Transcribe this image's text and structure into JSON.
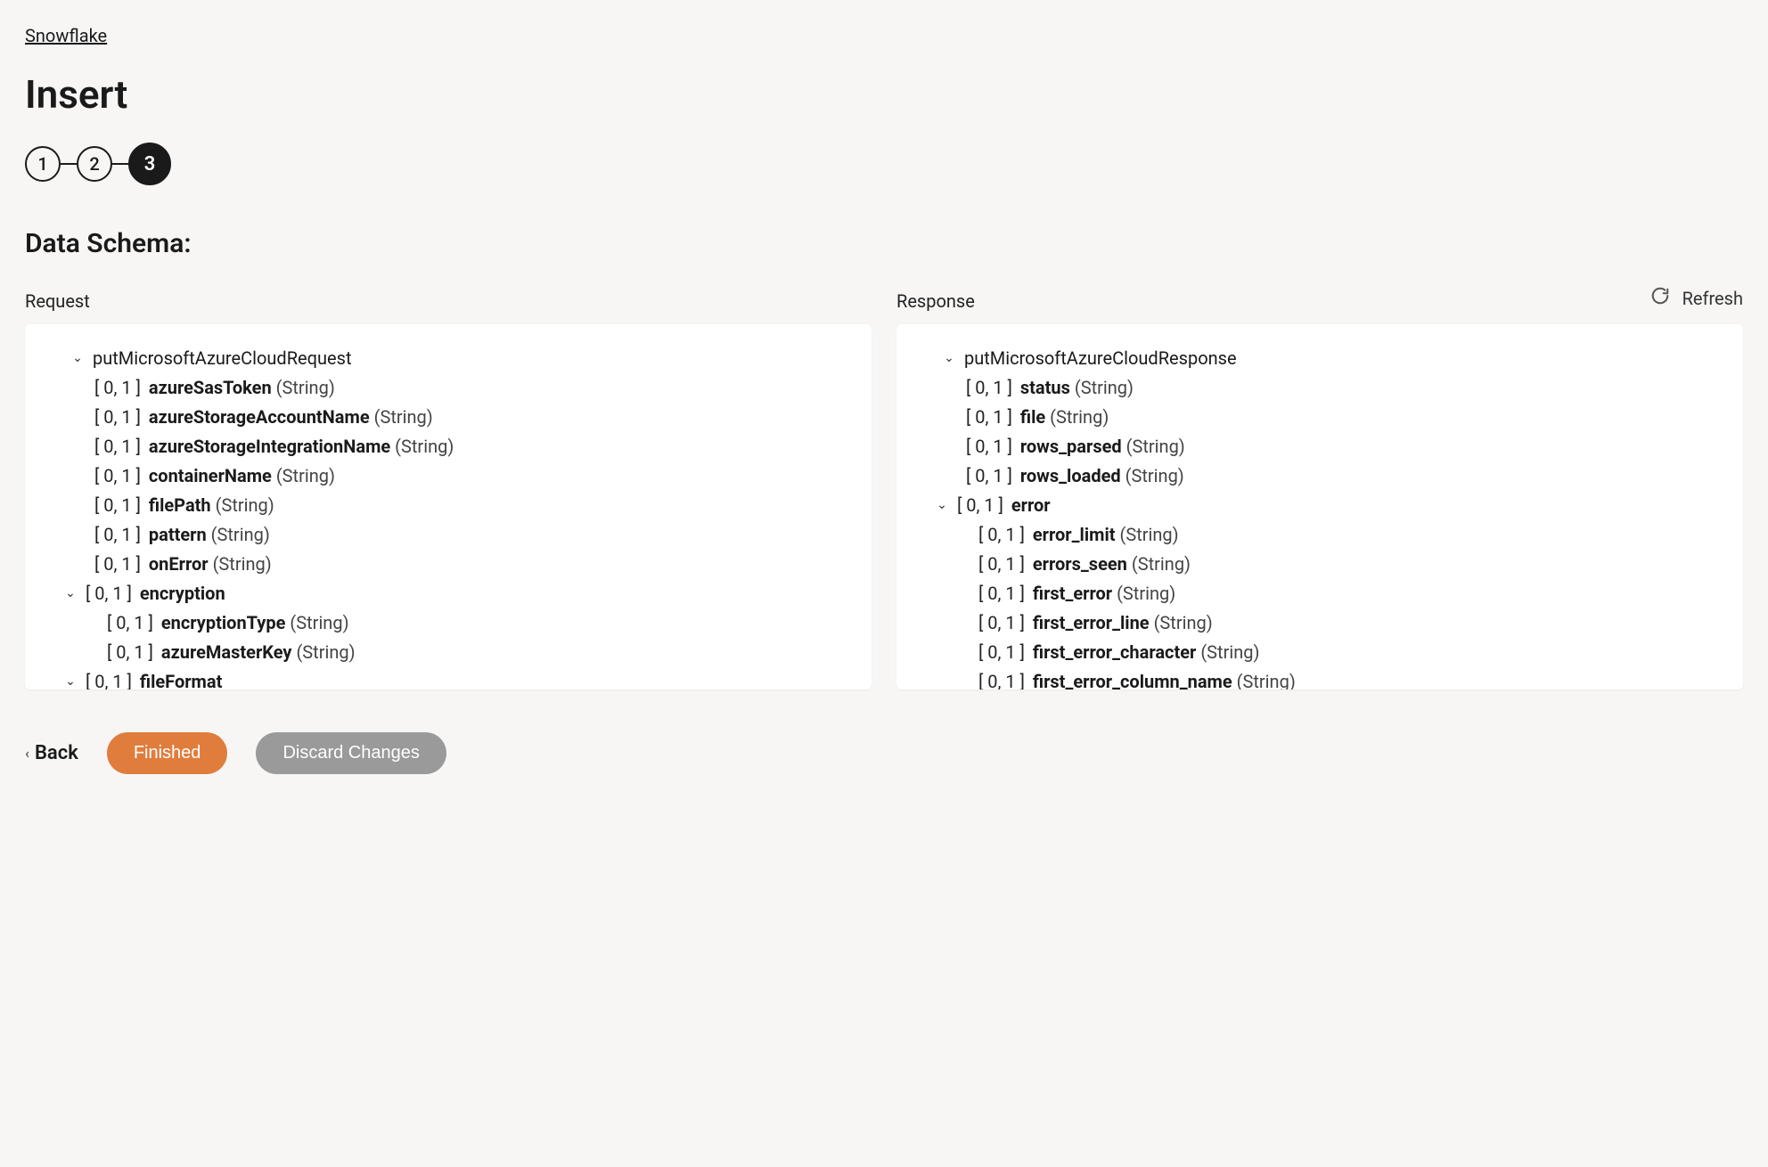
{
  "breadcrumb": {
    "label": "Snowflake"
  },
  "page": {
    "title": "Insert",
    "section_title": "Data Schema:"
  },
  "stepper": {
    "steps": [
      "1",
      "2",
      "3"
    ],
    "active_index": 2
  },
  "refresh": {
    "label": "Refresh"
  },
  "columns": {
    "request": {
      "header": "Request",
      "root": {
        "name": "putMicrosoftAzureCloudRequest",
        "expanded": true,
        "children": [
          {
            "card": "[ 0, 1 ]",
            "name": "azureSasToken",
            "type": "(String)"
          },
          {
            "card": "[ 0, 1 ]",
            "name": "azureStorageAccountName",
            "type": "(String)"
          },
          {
            "card": "[ 0, 1 ]",
            "name": "azureStorageIntegrationName",
            "type": "(String)"
          },
          {
            "card": "[ 0, 1 ]",
            "name": "containerName",
            "type": "(String)"
          },
          {
            "card": "[ 0, 1 ]",
            "name": "filePath",
            "type": "(String)"
          },
          {
            "card": "[ 0, 1 ]",
            "name": "pattern",
            "type": "(String)"
          },
          {
            "card": "[ 0, 1 ]",
            "name": "onError",
            "type": "(String)"
          },
          {
            "card": "[ 0, 1 ]",
            "name": "encryption",
            "expanded": true,
            "children": [
              {
                "card": "[ 0, 1 ]",
                "name": "encryptionType",
                "type": "(String)"
              },
              {
                "card": "[ 0, 1 ]",
                "name": "azureMasterKey",
                "type": "(String)"
              }
            ]
          },
          {
            "card": "[ 0, 1 ]",
            "name": "fileFormat",
            "expanded": true,
            "children": []
          }
        ]
      }
    },
    "response": {
      "header": "Response",
      "root": {
        "name": "putMicrosoftAzureCloudResponse",
        "expanded": true,
        "children": [
          {
            "card": "[ 0, 1 ]",
            "name": "status",
            "type": "(String)"
          },
          {
            "card": "[ 0, 1 ]",
            "name": "file",
            "type": "(String)"
          },
          {
            "card": "[ 0, 1 ]",
            "name": "rows_parsed",
            "type": "(String)"
          },
          {
            "card": "[ 0, 1 ]",
            "name": "rows_loaded",
            "type": "(String)"
          },
          {
            "card": "[ 0, 1 ]",
            "name": "error",
            "expanded": true,
            "children": [
              {
                "card": "[ 0, 1 ]",
                "name": "error_limit",
                "type": "(String)"
              },
              {
                "card": "[ 0, 1 ]",
                "name": "errors_seen",
                "type": "(String)"
              },
              {
                "card": "[ 0, 1 ]",
                "name": "first_error",
                "type": "(String)"
              },
              {
                "card": "[ 0, 1 ]",
                "name": "first_error_line",
                "type": "(String)"
              },
              {
                "card": "[ 0, 1 ]",
                "name": "first_error_character",
                "type": "(String)"
              },
              {
                "card": "[ 0, 1 ]",
                "name": "first_error_column_name",
                "type": "(String)"
              }
            ]
          }
        ]
      }
    }
  },
  "footer": {
    "back": "Back",
    "finished": "Finished",
    "discard": "Discard Changes"
  }
}
